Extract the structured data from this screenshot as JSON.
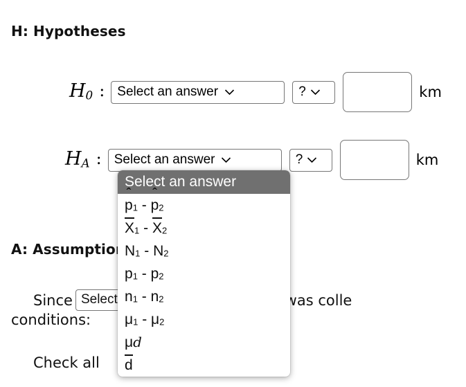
{
  "sections": {
    "hypotheses_heading": "H: Hypotheses",
    "assumptions_heading": "A: Assumptions"
  },
  "hypotheses": {
    "null": {
      "label_h": "H",
      "label_sub": "0",
      "colon": ":",
      "parameter_select": "Select an answer",
      "sign_select": "?",
      "value_input": "",
      "value_placeholder": "",
      "unit": "km"
    },
    "alternative": {
      "label_h": "H",
      "label_sub": "A",
      "colon": ":",
      "parameter_select": "Select an answer",
      "sign_select": "?",
      "value_input": "",
      "value_placeholder": "",
      "unit": "km"
    }
  },
  "dropdown": {
    "open": true,
    "selected": "Select an answer",
    "highlight_color": "#707070",
    "options": [
      {
        "text": "Select an answer",
        "selected": true
      },
      {
        "text": "p̂₁ - p̂₂",
        "selected": false
      },
      {
        "text": "X̄₁ - X̄₂",
        "selected": false
      },
      {
        "text": "N₁ - N₂",
        "selected": false
      },
      {
        "text": "p₁ - p₂",
        "selected": false
      },
      {
        "text": "n₁ - n₂",
        "selected": false
      },
      {
        "text": "μ₁ - μ₂",
        "selected": false
      },
      {
        "text": "μd",
        "selected": false
      },
      {
        "text": "d̄",
        "selected": false
      }
    ]
  },
  "assumptions": {
    "since_prefix": "Since",
    "inline_select": "Select an answer",
    "after_select_text": "formation was colle",
    "conditions_label": "conditions:",
    "check_all_text": "Check all"
  }
}
